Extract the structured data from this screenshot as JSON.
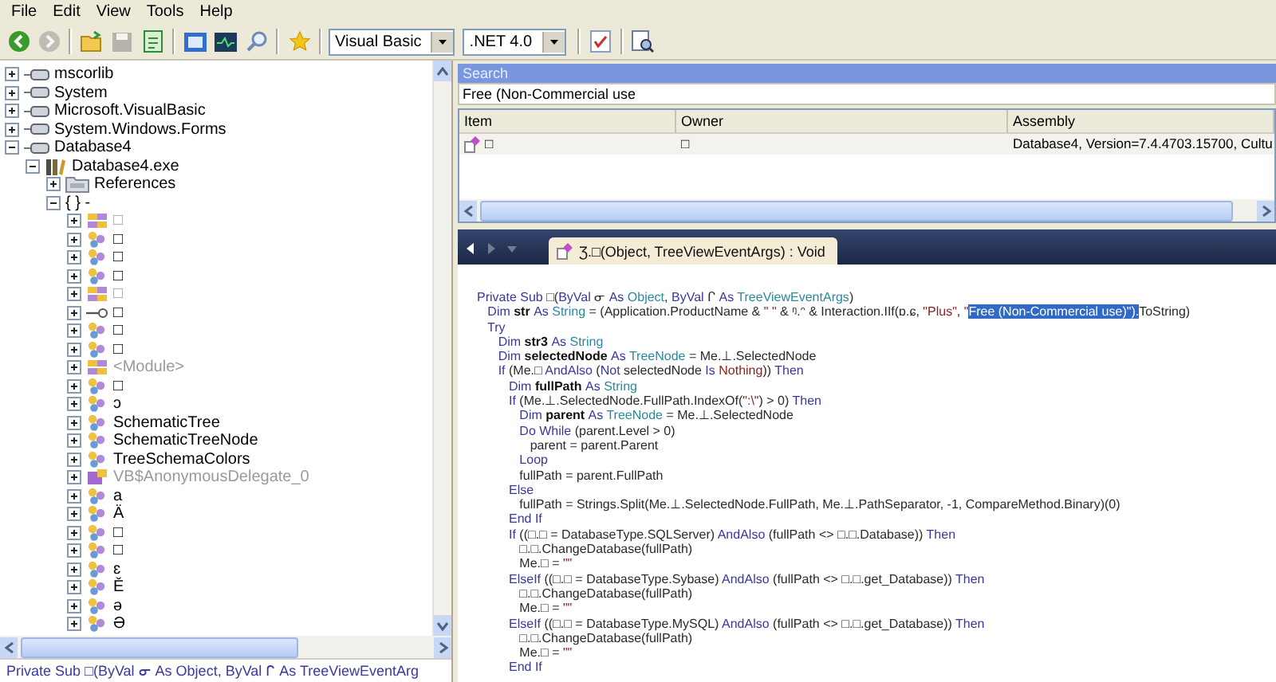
{
  "menu": [
    "File",
    "Edit",
    "View",
    "Tools",
    "Help"
  ],
  "toolbar": [
    {
      "kind": "back",
      "disabled": false
    },
    {
      "kind": "forward",
      "disabled": true
    },
    {
      "kind": "separator"
    },
    {
      "kind": "open",
      "disabled": false
    },
    {
      "kind": "save",
      "disabled": true
    },
    {
      "kind": "document",
      "disabled": false
    },
    {
      "kind": "separator"
    },
    {
      "kind": "textbox",
      "disabled": false
    },
    {
      "kind": "monitor",
      "disabled": false
    },
    {
      "kind": "search",
      "disabled": false
    },
    {
      "kind": "separator"
    },
    {
      "kind": "star",
      "disabled": false
    },
    {
      "kind": "separator"
    },
    {
      "kind": "select",
      "value": "Visual Basic"
    },
    {
      "kind": "select",
      "value": ".NET 4.0"
    },
    {
      "kind": "separator"
    },
    {
      "kind": "check",
      "disabled": false
    },
    {
      "kind": "separator"
    },
    {
      "kind": "page",
      "disabled": false
    }
  ],
  "tree": [
    {
      "label": "mscorlib",
      "kind": "assembly",
      "expanded": false,
      "dimmed": false
    },
    {
      "label": "System",
      "kind": "assembly",
      "expanded": false,
      "dimmed": false
    },
    {
      "label": "Microsoft.VisualBasic",
      "kind": "assembly",
      "expanded": false,
      "dimmed": false
    },
    {
      "label": "System.Windows.Forms",
      "kind": "assembly",
      "expanded": false,
      "dimmed": false
    },
    {
      "label": "Database4",
      "kind": "assembly",
      "expanded": true,
      "dimmed": false,
      "children": [
        {
          "label": "Database4.exe",
          "kind": "exe",
          "expanded": true,
          "dimmed": false,
          "children": [
            {
              "label": "References",
              "kind": "folder",
              "expanded": false,
              "dimmed": false
            },
            {
              "label": "{ } -",
              "kind": "namespace",
              "expanded": true,
              "dimmed": false,
              "children": [
                {
                  "label": "□",
                  "kind": "module",
                  "expanded": false,
                  "dimmed": true
                },
                {
                  "label": "□",
                  "kind": "class",
                  "expanded": false,
                  "dimmed": false
                },
                {
                  "label": "□",
                  "kind": "class",
                  "expanded": false,
                  "dimmed": false
                },
                {
                  "label": "□",
                  "kind": "class",
                  "expanded": false,
                  "dimmed": false
                },
                {
                  "label": "□",
                  "kind": "module",
                  "expanded": false,
                  "dimmed": true
                },
                {
                  "label": "□",
                  "kind": "interface",
                  "expanded": false,
                  "dimmed": false
                },
                {
                  "label": "□",
                  "kind": "class",
                  "expanded": false,
                  "dimmed": false
                },
                {
                  "label": "□",
                  "kind": "class",
                  "expanded": false,
                  "dimmed": false
                },
                {
                  "label": "<Module>",
                  "kind": "module",
                  "expanded": false,
                  "dimmed": true
                },
                {
                  "label": "□",
                  "kind": "class",
                  "expanded": false,
                  "dimmed": false
                },
                {
                  "label": "ɔ",
                  "kind": "class",
                  "expanded": false,
                  "dimmed": false
                },
                {
                  "label": "SchematicTree",
                  "kind": "class",
                  "expanded": false,
                  "dimmed": false
                },
                {
                  "label": "SchematicTreeNode",
                  "kind": "class",
                  "expanded": false,
                  "dimmed": false
                },
                {
                  "label": "TreeSchemaColors",
                  "kind": "class",
                  "expanded": false,
                  "dimmed": false
                },
                {
                  "label": "VB$AnonymousDelegate_0",
                  "kind": "delegate",
                  "expanded": false,
                  "dimmed": true
                },
                {
                  "label": "a",
                  "kind": "class",
                  "expanded": false,
                  "dimmed": false
                },
                {
                  "label": "Ä",
                  "kind": "class",
                  "expanded": false,
                  "dimmed": false
                },
                {
                  "label": "□",
                  "kind": "class",
                  "expanded": false,
                  "dimmed": false
                },
                {
                  "label": "□",
                  "kind": "class",
                  "expanded": false,
                  "dimmed": false
                },
                {
                  "label": "ɛ",
                  "kind": "class",
                  "expanded": false,
                  "dimmed": false
                },
                {
                  "label": "Ě",
                  "kind": "class",
                  "expanded": false,
                  "dimmed": false
                },
                {
                  "label": "ə",
                  "kind": "class",
                  "expanded": false,
                  "dimmed": false
                },
                {
                  "label": "Ə",
                  "kind": "class",
                  "expanded": false,
                  "dimmed": false
                }
              ]
            }
          ]
        }
      ]
    }
  ],
  "left_bottom_text": "Private Sub □(ByVal ᓂ As Object, ByVal ᒋ As TreeViewEventArg",
  "search": {
    "title": "Search",
    "value": "Free (Non-Commercial use"
  },
  "results": {
    "columns": [
      "Item",
      "Owner",
      "Assembly"
    ],
    "rows": [
      {
        "cells": [
          "□",
          "□",
          "Database4, Version=7.4.4703.15700, Cultu"
        ]
      }
    ]
  },
  "nav": [
    {
      "kind": "back",
      "disabled": false
    },
    {
      "kind": "forward",
      "disabled": true
    },
    {
      "kind": "history",
      "disabled": true
    }
  ],
  "tab": {
    "label": "Ʒ.□(Object, TreeViewEventArgs) : Void",
    "selected": true
  },
  "code": [
    [
      {
        "kind": "kw",
        "text": "Private Sub "
      },
      {
        "kind": "id",
        "text": "□("
      },
      {
        "kind": "kw",
        "text": "ByVal "
      },
      {
        "kind": "id",
        "text": "ᓂ "
      },
      {
        "kind": "kw",
        "text": "As "
      },
      {
        "kind": "type",
        "text": "Object"
      },
      {
        "kind": "id",
        "text": ", "
      },
      {
        "kind": "kw",
        "text": "ByVal "
      },
      {
        "kind": "id",
        "text": "ᒋ "
      },
      {
        "kind": "kw",
        "text": "As "
      },
      {
        "kind": "type",
        "text": "TreeViewEventArgs"
      },
      {
        "kind": "id",
        "text": ")"
      }
    ],
    [
      {
        "kind": "kw",
        "text": "   Dim "
      },
      {
        "kind": "name",
        "text": "str "
      },
      {
        "kind": "kw",
        "text": "As "
      },
      {
        "kind": "type",
        "text": "String"
      },
      {
        "kind": "id",
        "text": " = (Application.ProductName & "
      },
      {
        "kind": "str",
        "text": "\" \""
      },
      {
        "kind": "id",
        "text": " & ᵑ.ᵔ & Interaction.IIf(ɒ.ɕ, "
      },
      {
        "kind": "str",
        "text": "\"Plus\""
      },
      {
        "kind": "id",
        "text": ", "
      },
      {
        "kind": "str",
        "text": "\""
      },
      {
        "kind": "sel",
        "text": "Free (Non-Commercial use)\")."
      },
      {
        "kind": "id",
        "text": "ToString)"
      }
    ],
    [
      {
        "kind": "kw",
        "text": "   Try"
      }
    ],
    [
      {
        "kind": "kw",
        "text": "      Dim "
      },
      {
        "kind": "name",
        "text": "str3 "
      },
      {
        "kind": "kw",
        "text": "As "
      },
      {
        "kind": "type",
        "text": "String"
      }
    ],
    [
      {
        "kind": "kw",
        "text": "      Dim "
      },
      {
        "kind": "name",
        "text": "selectedNode "
      },
      {
        "kind": "kw",
        "text": "As "
      },
      {
        "kind": "type",
        "text": "TreeNode"
      },
      {
        "kind": "id",
        "text": " = Me.⊥.SelectedNode"
      }
    ],
    [
      {
        "kind": "kw",
        "text": "      If "
      },
      {
        "kind": "id",
        "text": "(Me.□ "
      },
      {
        "kind": "kw",
        "text": "AndAlso "
      },
      {
        "kind": "id",
        "text": "("
      },
      {
        "kind": "kw",
        "text": "Not "
      },
      {
        "kind": "id",
        "text": "selectedNode "
      },
      {
        "kind": "kw",
        "text": "Is "
      },
      {
        "kind": "lit",
        "text": "Nothing"
      },
      {
        "kind": "id",
        "text": ")) "
      },
      {
        "kind": "kw",
        "text": "Then"
      }
    ],
    [
      {
        "kind": "kw",
        "text": "         Dim "
      },
      {
        "kind": "name",
        "text": "fullPath "
      },
      {
        "kind": "kw",
        "text": "As "
      },
      {
        "kind": "type",
        "text": "String"
      }
    ],
    [
      {
        "kind": "kw",
        "text": "         If "
      },
      {
        "kind": "id",
        "text": "(Me.⊥.SelectedNode.FullPath.IndexOf("
      },
      {
        "kind": "str",
        "text": "\":\\\""
      },
      {
        "kind": "id",
        "text": ") > 0) "
      },
      {
        "kind": "kw",
        "text": "Then"
      }
    ],
    [
      {
        "kind": "kw",
        "text": "            Dim "
      },
      {
        "kind": "name",
        "text": "parent "
      },
      {
        "kind": "kw",
        "text": "As "
      },
      {
        "kind": "type",
        "text": "TreeNode"
      },
      {
        "kind": "id",
        "text": " = Me.⊥.SelectedNode"
      }
    ],
    [
      {
        "kind": "kw",
        "text": "            Do While "
      },
      {
        "kind": "id",
        "text": "(parent.Level > 0)"
      }
    ],
    [
      {
        "kind": "id",
        "text": "               parent = parent.Parent"
      }
    ],
    [
      {
        "kind": "kw",
        "text": "            Loop"
      }
    ],
    [
      {
        "kind": "id",
        "text": "            fullPath = parent.FullPath"
      }
    ],
    [
      {
        "kind": "kw",
        "text": "         Else"
      }
    ],
    [
      {
        "kind": "id",
        "text": "            fullPath = Strings.Split(Me.⊥.SelectedNode.FullPath, Me.⊥.PathSeparator, -1, CompareMethod.Binary)(0)"
      }
    ],
    [
      {
        "kind": "kw",
        "text": "         End If"
      }
    ],
    [
      {
        "kind": "kw",
        "text": "         If "
      },
      {
        "kind": "id",
        "text": "((□.□ = DatabaseType.SQLServer) "
      },
      {
        "kind": "kw",
        "text": "AndAlso "
      },
      {
        "kind": "id",
        "text": "(fullPath <> □.□.Database)) "
      },
      {
        "kind": "kw",
        "text": "Then"
      }
    ],
    [
      {
        "kind": "id",
        "text": "            □.□.ChangeDatabase(fullPath)"
      }
    ],
    [
      {
        "kind": "id",
        "text": "            Me.□ = "
      },
      {
        "kind": "str",
        "text": "\"\""
      }
    ],
    [
      {
        "kind": "kw",
        "text": "         ElseIf "
      },
      {
        "kind": "id",
        "text": "((□.□ = DatabaseType.Sybase) "
      },
      {
        "kind": "kw",
        "text": "AndAlso "
      },
      {
        "kind": "id",
        "text": "(fullPath <> □.□.get_Database)) "
      },
      {
        "kind": "kw",
        "text": "Then"
      }
    ],
    [
      {
        "kind": "id",
        "text": "            □.□.ChangeDatabase(fullPath)"
      }
    ],
    [
      {
        "kind": "id",
        "text": "            Me.□ = "
      },
      {
        "kind": "str",
        "text": "\"\""
      }
    ],
    [
      {
        "kind": "kw",
        "text": "         ElseIf "
      },
      {
        "kind": "id",
        "text": "((□.□ = DatabaseType.MySQL) "
      },
      {
        "kind": "kw",
        "text": "AndAlso "
      },
      {
        "kind": "id",
        "text": "(fullPath <> □.□.get_Database)) "
      },
      {
        "kind": "kw",
        "text": "Then"
      }
    ],
    [
      {
        "kind": "id",
        "text": "            □.□.ChangeDatabase(fullPath)"
      }
    ],
    [
      {
        "kind": "id",
        "text": "            Me.□ = "
      },
      {
        "kind": "str",
        "text": "\"\""
      }
    ],
    [
      {
        "kind": "kw",
        "text": "         End If"
      }
    ]
  ]
}
